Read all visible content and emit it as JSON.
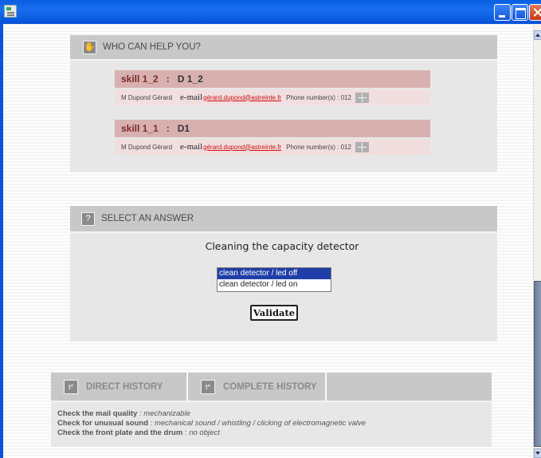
{
  "window": {
    "controls": [
      "minimize-icon",
      "maximize-icon",
      "close-icon"
    ]
  },
  "help": {
    "title": "WHO CAN HELP YOU?",
    "icon": "hand-icon",
    "skills": [
      {
        "name": "skill 1_2",
        "sep": ":",
        "code": "D 1_2",
        "person": "M Dupond Gérard",
        "mail_label": "e-mail",
        "mail": "gérard.dupond@astreinte.fr",
        "phone": "Phone number(s) : 012"
      },
      {
        "name": "skill 1_1",
        "sep": ":",
        "code": "D1",
        "person": "M Dupond Gérard",
        "mail_label": "e-mail",
        "mail": "gérard.dupond@astreinte.fr",
        "phone": "Phone number(s) : 012"
      }
    ]
  },
  "answer": {
    "title": "SELECT AN ANSWER",
    "icon_glyph": "?",
    "question": "Cleaning the capacity detector",
    "options": [
      "clean detector / led off",
      "clean detector / led on"
    ],
    "selected_index": 0,
    "validate_label": "Validate"
  },
  "history": {
    "tabs": [
      {
        "label": "DIRECT HISTORY",
        "icon": "history-icon"
      },
      {
        "label": "COMPLETE HISTORY",
        "icon": "history-icon"
      }
    ],
    "lines": [
      {
        "label": "Check the mail quality",
        "sep": " : ",
        "value": "mechanizable"
      },
      {
        "label": "Check for unusual sound",
        "sep": " : ",
        "value": "mechanical sound / whistling / clicking of electromagnetic valve"
      },
      {
        "label": "Check the front plate and the drum",
        "sep": " : ",
        "value": "no object"
      }
    ]
  },
  "colors": {
    "titlebar": "#0a5fe0",
    "skill_header": "#d9b0b0",
    "skill_row": "#f1dede",
    "skill_name": "#7a2a2a",
    "mail_link": "#cc1111",
    "selected_option": "#1f3fa8",
    "section_header": "#c8c8c8",
    "panel": "#e7e7e7"
  }
}
